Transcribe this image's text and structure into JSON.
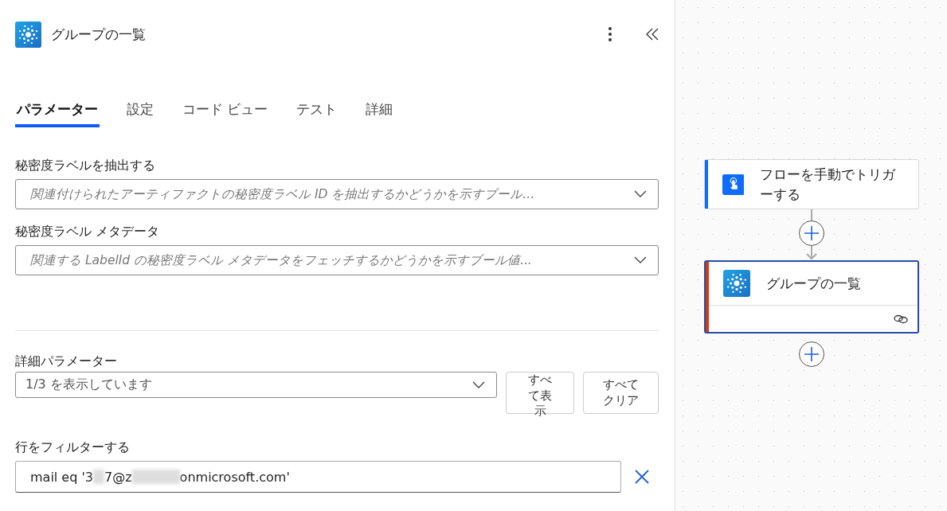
{
  "panel": {
    "title": "グループの一覧"
  },
  "tabs": [
    {
      "label": "パラメーター",
      "selected": true
    },
    {
      "label": "設定",
      "selected": false
    },
    {
      "label": "コード ビュー",
      "selected": false
    },
    {
      "label": "テスト",
      "selected": false
    },
    {
      "label": "詳細",
      "selected": false
    }
  ],
  "fields": [
    {
      "label": "秘密度ラベルを抽出する",
      "placeholder": "関連付けられたアーティファクトの秘密度ラベル ID を抽出するかどうかを示すブール..."
    },
    {
      "label": "秘密度ラベル メタデータ",
      "placeholder": "関連する LabelId の秘密度ラベル メタデータをフェッチするかどうかを示すブール値..."
    }
  ],
  "advanced": {
    "label": "詳細パラメーター",
    "value": "1/3 を表示しています",
    "buttons": [
      "すべて表示",
      "すべてクリア"
    ]
  },
  "filter": {
    "label": "行をフィルターする",
    "value_parts": [
      "mail eq '3",
      "7@z",
      "onmicrosoft.com'"
    ]
  },
  "nodes": [
    {
      "kind": "trigger",
      "title": "フローを手動でトリガーする",
      "color": "#0f6cfd",
      "selected": false
    },
    {
      "kind": "action",
      "title": "グループの一覧",
      "color": "#d13b12",
      "selected": true
    }
  ]
}
